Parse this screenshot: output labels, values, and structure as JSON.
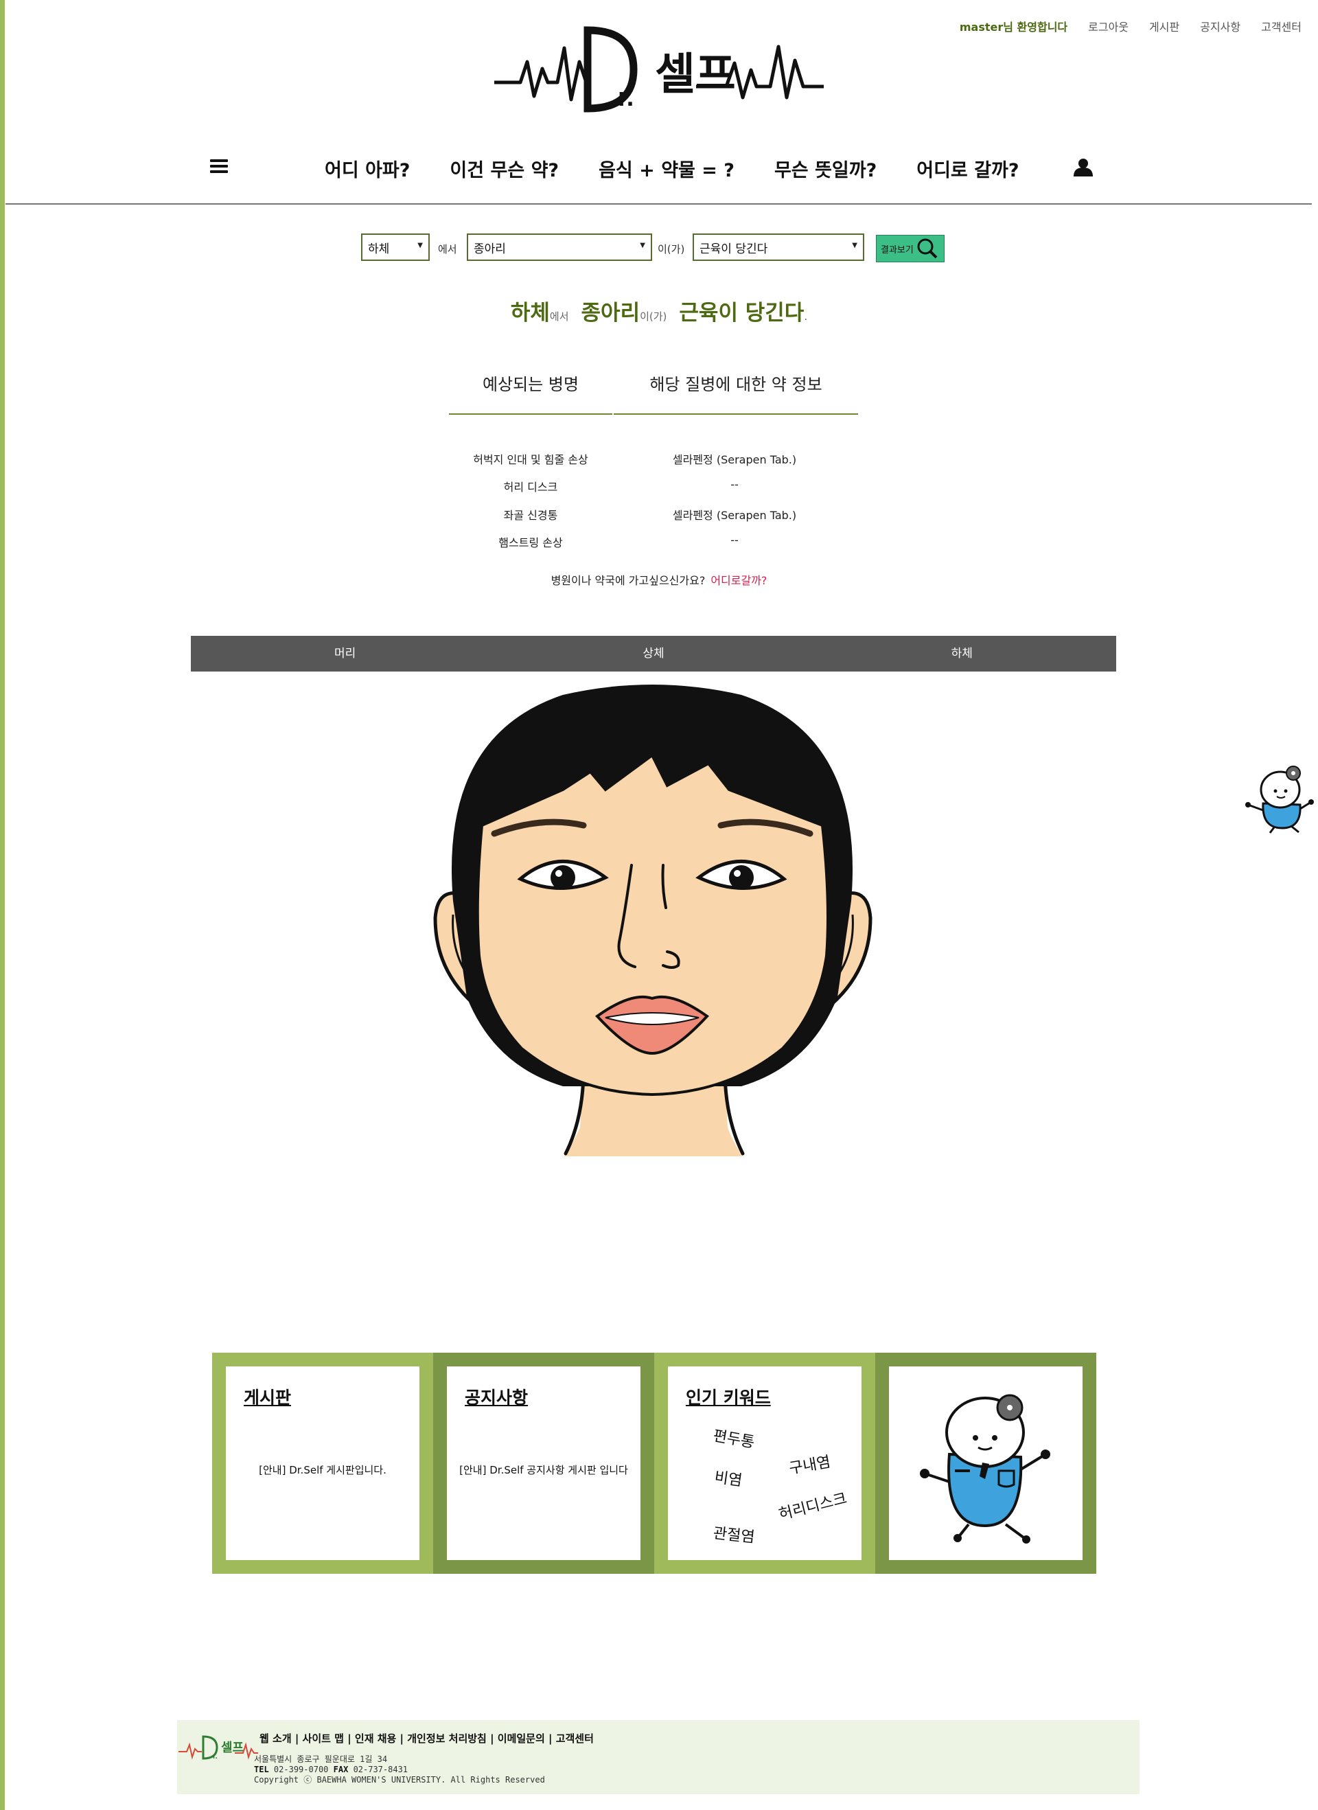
{
  "header": {
    "welcome": "master님 환영합니다",
    "links": [
      "로그아웃",
      "게시판",
      "공지사항",
      "고객센터"
    ]
  },
  "logo": {
    "text": "Dr.셀프"
  },
  "nav": {
    "items": [
      "어디 아파?",
      "이건 무슨 약?",
      "음식 + 약물 = ?",
      "무슨 뜻일까?",
      "어디로 갈까?"
    ]
  },
  "search": {
    "part": "하체",
    "part_suffix": "에서",
    "area": "종아리",
    "area_suffix": "이(가)",
    "symptom": "근육이 당긴다",
    "button_label": "결과보기"
  },
  "headline": {
    "part": "하체",
    "part_suffix": "에서",
    "area": "종아리",
    "area_suffix": "이(가)",
    "symptom": "근육이 당긴다",
    "period": "."
  },
  "result_tabs": [
    "예상되는 병명",
    "해당 질병에 대한 약 정보"
  ],
  "results": [
    {
      "disease": "허벅지 인대 및 힘줄 손상",
      "medicine": "셀라펜정 (Serapen Tab.)"
    },
    {
      "disease": "허리 디스크",
      "medicine": "--"
    },
    {
      "disease": "좌골 신경통",
      "medicine": "셀라펜정 (Serapen Tab.)"
    },
    {
      "disease": "햄스트링 손상",
      "medicine": "--"
    }
  ],
  "hospital_prompt": "병원이나 약국에 가고싶으신가요?",
  "hospital_link": "어디로갈까?",
  "body_tabs": [
    "머리",
    "상체",
    "하체"
  ],
  "cards": {
    "board": {
      "title": "게시판",
      "body": "[안내] Dr.Self 게시판입니다."
    },
    "notice": {
      "title": "공지사항",
      "body": "[안내] Dr.Self 공지사항 게시판 입니다"
    },
    "keywords": {
      "title": "인기 키워드",
      "items": [
        "편두통",
        "구내염",
        "비염",
        "허리디스크",
        "관절염"
      ]
    }
  },
  "footer": {
    "links": "웹 소개 | 사이트 맵 | 인재 채용 | 개인정보 처리방침 | 이메일문의 | 고객센터",
    "address": "서울특별시 종로구 필운대로 1길 34",
    "tel_label": "TEL",
    "tel": "02-399-0700",
    "fax_label": "FAX",
    "fax": "02-737-8431",
    "copyright": "Copyright ⓒ BAEWHA WOMEN'S UNIVERSITY. All Rights Reserved"
  },
  "colors": {
    "accent_green": "#4d6a12",
    "card_light": "#9fba5a",
    "card_dark": "#7a9646",
    "link_red": "#d61f4a",
    "tab_bar": "#575757"
  }
}
